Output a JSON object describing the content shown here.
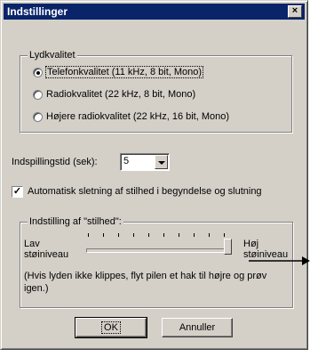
{
  "window": {
    "title": "Indstillinger",
    "close_glyph": "×"
  },
  "quality": {
    "legend": "Lydkvalitet",
    "options": [
      {
        "label": "Telefonkvalitet (11 kHz, 8 bit, Mono)",
        "selected": true
      },
      {
        "label": "Radiokvalitet (22 kHz, 8 bit, Mono)",
        "selected": false
      },
      {
        "label": "Højere radiokvalitet (22 kHz, 16 bit, Mono)",
        "selected": false
      }
    ]
  },
  "recording": {
    "label": "Indspillingstid (sek):",
    "value": "5"
  },
  "auto_trim": {
    "label": "Automatisk sletning af stilhed i begyndelse og slutning",
    "checked": true,
    "check_glyph": "✓"
  },
  "silence": {
    "legend": "Indstilling af \"stilhed\":",
    "low_label_1": "Lav",
    "low_label_2": "støiniveau",
    "high_label_1": "Høj",
    "high_label_2": "støiniveau",
    "slider_value": 1.0,
    "hint": "(Hvis lyden ikke klippes, flyt pilen et hak til højre og prøv igen.)"
  },
  "buttons": {
    "ok": "OK",
    "cancel": "Annuller"
  }
}
